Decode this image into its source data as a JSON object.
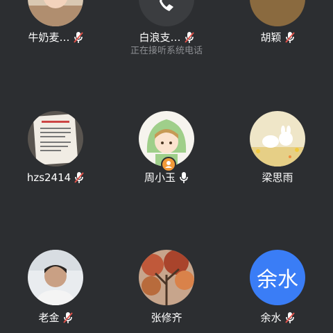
{
  "participants": [
    {
      "name": "牛奶麦…",
      "mic": "muted"
    },
    {
      "name": "白浪支…",
      "mic": "muted",
      "status": "正在接听系统电话"
    },
    {
      "name": "胡颖",
      "mic": "muted"
    },
    {
      "name": "hzs2414",
      "mic": "muted"
    },
    {
      "name": "周小玉",
      "mic": "on",
      "host_badge": true
    },
    {
      "name": "梁思雨",
      "mic": "none"
    },
    {
      "name": "老金",
      "mic": "muted"
    },
    {
      "name": "张修齐",
      "mic": "none"
    },
    {
      "name": "余水",
      "mic": "muted",
      "avatar_text": "余水"
    }
  ],
  "colors": {
    "background": "#2c2e31",
    "name_text": "#ffffff",
    "status_text": "#8d8f93",
    "muted_slash": "#e0524b",
    "host_badge": "#f29a38",
    "text_avatar_bg": "#3a7df6"
  }
}
